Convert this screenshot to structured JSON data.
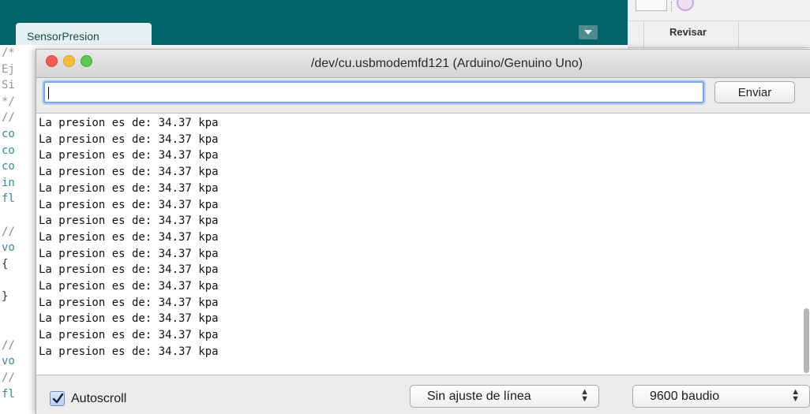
{
  "ide": {
    "sketch_tab": "SensorPresion",
    "right_tab": "Revisar",
    "editor_fragments": [
      {
        "text": "/*",
        "color": "#959595"
      },
      {
        "text": "Ej",
        "color": "#959595"
      },
      {
        "text": "Si",
        "color": "#959595"
      },
      {
        "text": "*/",
        "color": "#959595"
      },
      {
        "text": "//",
        "color": "#8a8a8a"
      },
      {
        "text": "co",
        "color": "#3a8a90"
      },
      {
        "text": "co",
        "color": "#3a8a90"
      },
      {
        "text": "co",
        "color": "#3a8a90"
      },
      {
        "text": "in",
        "color": "#3a8a90"
      },
      {
        "text": "fl",
        "color": "#3a8a90"
      },
      {
        "text": "",
        "color": "#333333"
      },
      {
        "text": "//",
        "color": "#8a8a8a"
      },
      {
        "text": "vo",
        "color": "#3a8a90"
      },
      {
        "text": "{ ",
        "color": "#333333"
      },
      {
        "text": " ",
        "color": "#333333"
      },
      {
        "text": "}",
        "color": "#333333"
      },
      {
        "text": "",
        "color": "#333333"
      },
      {
        "text": "",
        "color": "#333333"
      },
      {
        "text": "//",
        "color": "#8a8a8a"
      },
      {
        "text": "vo",
        "color": "#3a8a90"
      },
      {
        "text": "//",
        "color": "#8a8a8a"
      },
      {
        "text": "fl",
        "color": "#3a8a90"
      }
    ]
  },
  "serial_monitor": {
    "title": "/dev/cu.usbmodemfd121 (Arduino/Genuino Uno)",
    "input": {
      "value": "",
      "placeholder": ""
    },
    "send_label": "Enviar",
    "output_lines": [
      "La presion es de: 34.37 kpa",
      "La presion es de: 34.37 kpa",
      "La presion es de: 34.37 kpa",
      "La presion es de: 34.37 kpa",
      "La presion es de: 34.37 kpa",
      "La presion es de: 34.37 kpa",
      "La presion es de: 34.37 kpa",
      "La presion es de: 34.37 kpa",
      "La presion es de: 34.37 kpa",
      "La presion es de: 34.37 kpa",
      "La presion es de: 34.37 kpa",
      "La presion es de: 34.37 kpa",
      "La presion es de: 34.37 kpa",
      "La presion es de: 34.37 kpa",
      "La presion es de: 34.37 kpa"
    ],
    "autoscroll_label": "Autoscroll",
    "autoscroll_checked": true,
    "line_ending": "Sin ajuste de línea",
    "baud_rate": "9600 baudio"
  },
  "icons": {
    "window_close": "close-traffic-light-icon",
    "window_minimize": "minimize-traffic-light-icon",
    "window_zoom": "zoom-traffic-light-icon",
    "select_arrows": "updown-chevron-icon",
    "checkmark": "checkmark-icon"
  },
  "colors": {
    "ide_teal": "#006468",
    "traffic_red": "#f25a56",
    "traffic_yellow": "#f6bd3b",
    "traffic_green": "#5fc650",
    "focus_blue": "#7aa7e6"
  }
}
